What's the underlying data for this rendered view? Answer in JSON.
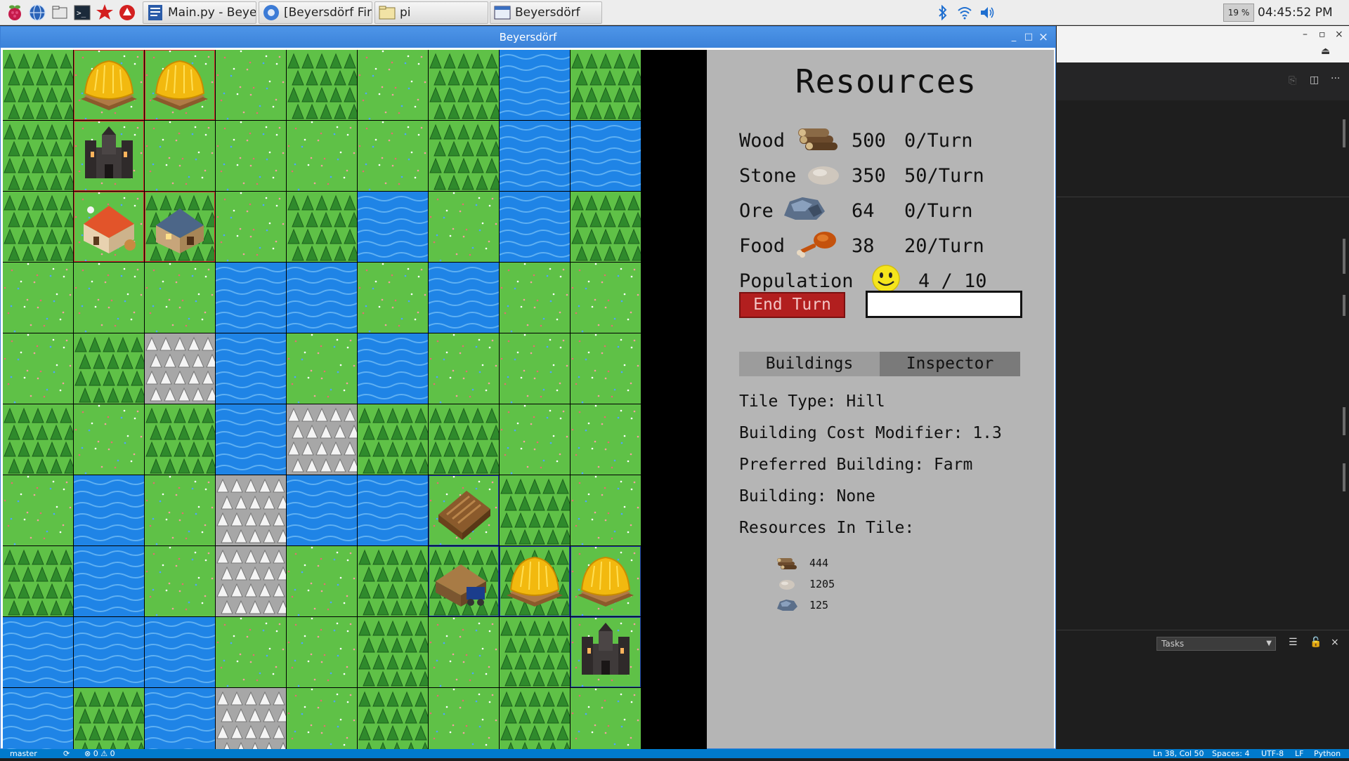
{
  "taskbar": {
    "launchers": [
      {
        "name": "raspberry-menu-icon"
      },
      {
        "name": "web-browser-icon"
      },
      {
        "name": "file-manager-icon"
      },
      {
        "name": "terminal-icon"
      },
      {
        "name": "math-kernel-icon"
      },
      {
        "name": "wolfram-icon"
      }
    ],
    "tasks": [
      {
        "label": "Main.py - Beyersdorf ...",
        "icon": "text-editor-icon"
      },
      {
        "label": "[Beyersdörf Final Re...",
        "icon": "chromium-icon"
      },
      {
        "label": "pi",
        "icon": "folder-icon"
      },
      {
        "label": "Beyersdörf",
        "icon": "window-icon"
      }
    ],
    "cpu": "19 %",
    "clock": "04:45:52 PM"
  },
  "window": {
    "title": "Beyersdörf",
    "minimize": "_",
    "maximize": "□",
    "close": "×"
  },
  "map": {
    "legend": {
      "F": "forest",
      "G": "grass",
      "W": "water",
      "M": "mountain",
      "H": "hill"
    },
    "rows": [
      "FGGGFGFWF",
      "FGGGGGFWW",
      "FGFGFWGWF",
      "GGGWWGWGG",
      "GFMWGWGGG",
      "FGFWMFFGG",
      "GWGMWWGFG",
      "FWGMGFFFG",
      "WWWGGFGFG",
      "WFWMGFGFG"
    ],
    "buildings": [
      {
        "row": 0,
        "col": 1,
        "type": "farm",
        "owner": "red"
      },
      {
        "row": 0,
        "col": 2,
        "type": "farm",
        "owner": "red"
      },
      {
        "row": 1,
        "col": 1,
        "type": "castle",
        "owner": "red"
      },
      {
        "row": 2,
        "col": 1,
        "type": "house",
        "owner": "red"
      },
      {
        "row": 2,
        "col": 2,
        "type": "workshop",
        "owner": "red"
      },
      {
        "row": 6,
        "col": 6,
        "type": "lumber-mill",
        "owner": "blue"
      },
      {
        "row": 7,
        "col": 6,
        "type": "mine",
        "owner": "blue"
      },
      {
        "row": 7,
        "col": 7,
        "type": "farm",
        "owner": "blue"
      },
      {
        "row": 7,
        "col": 8,
        "type": "farm",
        "owner": "blue"
      },
      {
        "row": 8,
        "col": 8,
        "type": "castle",
        "owner": "blue"
      }
    ],
    "claimed": [
      {
        "row": 0,
        "col": 1,
        "owner": "red"
      },
      {
        "row": 0,
        "col": 2,
        "owner": "red"
      },
      {
        "row": 1,
        "col": 1,
        "owner": "red"
      },
      {
        "row": 2,
        "col": 1,
        "owner": "red"
      },
      {
        "row": 2,
        "col": 2,
        "owner": "red"
      },
      {
        "row": 6,
        "col": 6,
        "owner": "blue"
      },
      {
        "row": 7,
        "col": 6,
        "owner": "blue"
      },
      {
        "row": 7,
        "col": 7,
        "owner": "blue"
      },
      {
        "row": 7,
        "col": 8,
        "owner": "blue"
      },
      {
        "row": 8,
        "col": 8,
        "owner": "blue"
      }
    ],
    "colors": {
      "grass": "#5fc147",
      "water": "#1f84e6",
      "forest": "#2f8a2c",
      "mountain": "#a7a7a7",
      "red_owner": "#d42a2a",
      "blue_owner": "#1f3fb0"
    }
  },
  "panel": {
    "title": "Resources",
    "resources": [
      {
        "name": "Wood",
        "icon": "wood-logs-icon",
        "amount": "500",
        "rate": "0/Turn"
      },
      {
        "name": "Stone",
        "icon": "stone-icon",
        "amount": "350",
        "rate": "50/Turn"
      },
      {
        "name": "Ore",
        "icon": "ore-icon",
        "amount": "64",
        "rate": "0/Turn"
      },
      {
        "name": "Food",
        "icon": "meat-icon",
        "amount": "38",
        "rate": "20/Turn"
      }
    ],
    "population": {
      "label": "Population",
      "icon": "smiley-icon",
      "value": "4 / 10"
    },
    "end_turn": "End Turn",
    "turn_input_value": "",
    "tabs": {
      "buildings": "Buildings",
      "inspector": "Inspector"
    },
    "inspector": {
      "tile_type": "Tile Type: Hill",
      "cost_modifier": "Building Cost Modifier: 1.3",
      "preferred": "Preferred Building: Farm",
      "building": "Building: None",
      "resources_heading": "Resources In Tile:",
      "tile_resources": [
        {
          "icon": "wood-logs-icon",
          "value": "444"
        },
        {
          "icon": "stone-icon",
          "value": "1205"
        },
        {
          "icon": "ore-icon",
          "value": "125"
        }
      ]
    }
  },
  "editor": {
    "tasks_label": "Tasks"
  },
  "statusbar": {
    "branch": "master",
    "sync": "⟳",
    "problems": "⊗ 0 ⚠ 0",
    "position": "Ln 38, Col 50",
    "spaces": "Spaces: 4",
    "encoding": "UTF-8",
    "eol": "LF",
    "language": "Python"
  }
}
